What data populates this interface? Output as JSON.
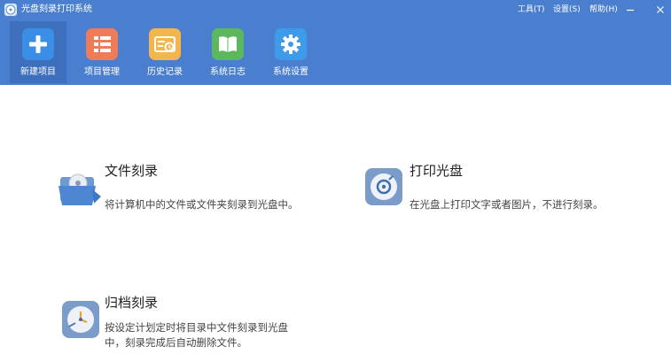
{
  "window": {
    "title": "光盘刻录打印系统",
    "menu": [
      {
        "label": "工具(T)"
      },
      {
        "label": "设置(S)"
      },
      {
        "label": "帮助(H)"
      }
    ],
    "controls": {
      "minimize": "minimize-icon",
      "close": "close-icon"
    }
  },
  "toolbar": {
    "items": [
      {
        "label": "新建项目",
        "icon": "plus-icon",
        "color": "#3a8ee6",
        "active": true
      },
      {
        "label": "项目管理",
        "icon": "list-icon",
        "color": "#ef7b57"
      },
      {
        "label": "历史记录",
        "icon": "history-icon",
        "color": "#f2b64c"
      },
      {
        "label": "系统日志",
        "icon": "book-icon",
        "color": "#5cb85c"
      },
      {
        "label": "系统设置",
        "icon": "gear-icon",
        "color": "#3d9be9"
      }
    ]
  },
  "features": [
    {
      "title": "文件刻录",
      "desc": "将计算机中的文件或文件夹刻录到光盘中。",
      "icon": "folder-disc-icon"
    },
    {
      "title": "打印光盘",
      "desc": "在光盘上打印文字或者图片，不进行刻录。",
      "icon": "disc-print-icon"
    },
    {
      "title": "归档刻录",
      "desc": "按设定计划定时将目录中文件刻录到光盘中，刻录完成后自动删除文件。",
      "icon": "archive-clock-icon"
    }
  ],
  "colors": {
    "header": "#4a7fcf",
    "active_tab": "#3e6fbd",
    "content_bg": "#ffffff"
  }
}
